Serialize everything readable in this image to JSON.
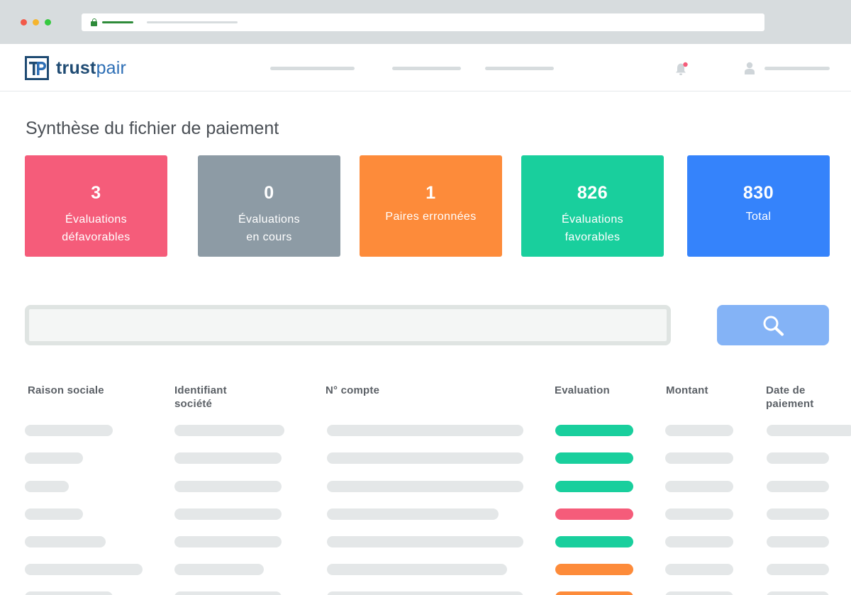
{
  "brand": {
    "name_part1": "trust",
    "name_part2": "pair"
  },
  "page": {
    "title": "Synthèse du fichier de paiement"
  },
  "cards": [
    {
      "value": "3",
      "label": "Évaluations\ndéfavorables",
      "color": "#f55c7a"
    },
    {
      "value": "0",
      "label": "Évaluations\nen cours",
      "color": "#8d9ba5"
    },
    {
      "value": "1",
      "label": "Paires erronnées",
      "color": "#fd8b3a"
    },
    {
      "value": "826",
      "label": "Évaluations\nfavorables",
      "color": "#19cf9d"
    },
    {
      "value": "830",
      "label": "Total",
      "color": "#3583fb"
    }
  ],
  "search": {
    "value": "",
    "button_icon": "search-icon"
  },
  "table": {
    "columns": [
      "Raison sociale",
      "Identifiant\nsociété",
      "N° compte",
      "Evaluation",
      "Montant",
      "Date de\npaiement"
    ],
    "rows": [
      {
        "evaluation": "favorable"
      },
      {
        "evaluation": "favorable"
      },
      {
        "evaluation": "favorable"
      },
      {
        "evaluation": "defavorable"
      },
      {
        "evaluation": "favorable"
      },
      {
        "evaluation": "erronee"
      },
      {
        "evaluation": "erronee"
      }
    ],
    "evaluation_colors": {
      "favorable": "#19cf9d",
      "defavorable": "#f55c7a",
      "erronee": "#fd8b3a"
    }
  },
  "icons": {
    "notifications": "bell-icon",
    "user": "user-icon"
  },
  "colors": {
    "notification_dot": "#f55c7a",
    "secure_lock": "#2e8b3a"
  }
}
